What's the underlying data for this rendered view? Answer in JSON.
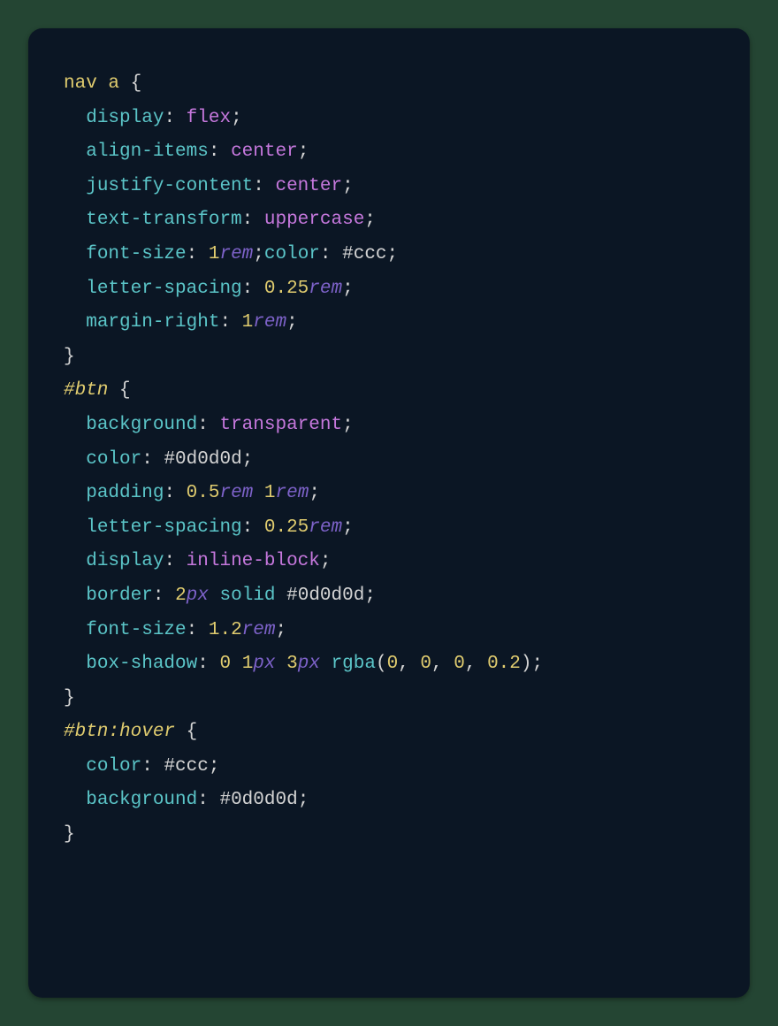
{
  "code": {
    "rules": [
      {
        "selector_parts": [
          {
            "text": "nav a",
            "cls": "tok-selector"
          }
        ],
        "decls": [
          [
            {
              "prop": "display"
            },
            {
              "value_parts": [
                {
                  "text": "flex",
                  "cls": "tok-value"
                }
              ]
            }
          ],
          [
            {
              "prop": "align-items"
            },
            {
              "value_parts": [
                {
                  "text": "center",
                  "cls": "tok-value"
                }
              ]
            }
          ],
          [
            {
              "prop": "justify-content"
            },
            {
              "value_parts": [
                {
                  "text": "center",
                  "cls": "tok-value"
                }
              ]
            }
          ],
          [
            {
              "prop": "text-transform"
            },
            {
              "value_parts": [
                {
                  "text": "uppercase",
                  "cls": "tok-value"
                }
              ]
            }
          ],
          [
            {
              "prop": "font-size"
            },
            {
              "value_parts": [
                {
                  "text": "1",
                  "cls": "tok-num"
                },
                {
                  "text": "rem",
                  "cls": "tok-unit"
                }
              ]
            },
            {
              "inline_next": {
                "prop": "color",
                "value_parts": [
                  {
                    "text": "#ccc",
                    "cls": "tok-hex"
                  }
                ]
              }
            }
          ],
          [
            {
              "prop": "letter-spacing"
            },
            {
              "value_parts": [
                {
                  "text": "0.25",
                  "cls": "tok-num"
                },
                {
                  "text": "rem",
                  "cls": "tok-unit"
                }
              ]
            }
          ],
          [
            {
              "prop": "margin-right"
            },
            {
              "value_parts": [
                {
                  "text": "1",
                  "cls": "tok-num"
                },
                {
                  "text": "rem",
                  "cls": "tok-unit"
                }
              ]
            }
          ]
        ]
      },
      {
        "selector_parts": [
          {
            "text": "#btn",
            "cls": "tok-id-italic"
          }
        ],
        "decls": [
          [
            {
              "prop": "background"
            },
            {
              "value_parts": [
                {
                  "text": "transparent",
                  "cls": "tok-value"
                }
              ]
            }
          ],
          [
            {
              "prop": "color"
            },
            {
              "value_parts": [
                {
                  "text": "#0d0d0d",
                  "cls": "tok-hex"
                }
              ]
            }
          ],
          [
            {
              "prop": "padding"
            },
            {
              "value_parts": [
                {
                  "text": "0.5",
                  "cls": "tok-num"
                },
                {
                  "text": "rem",
                  "cls": "tok-unit"
                },
                {
                  "text": " ",
                  "cls": ""
                },
                {
                  "text": "1",
                  "cls": "tok-num"
                },
                {
                  "text": "rem",
                  "cls": "tok-unit"
                }
              ]
            }
          ],
          [
            {
              "prop": "letter-spacing"
            },
            {
              "value_parts": [
                {
                  "text": "0.25",
                  "cls": "tok-num"
                },
                {
                  "text": "rem",
                  "cls": "tok-unit"
                }
              ]
            }
          ],
          [
            {
              "prop": "display"
            },
            {
              "value_parts": [
                {
                  "text": "inline-block",
                  "cls": "tok-value"
                }
              ]
            }
          ],
          [
            {
              "prop": "border"
            },
            {
              "value_parts": [
                {
                  "text": "2",
                  "cls": "tok-num"
                },
                {
                  "text": "px",
                  "cls": "tok-unit"
                },
                {
                  "text": " ",
                  "cls": ""
                },
                {
                  "text": "solid",
                  "cls": "tok-kw"
                },
                {
                  "text": " ",
                  "cls": ""
                },
                {
                  "text": "#0d0d0d",
                  "cls": "tok-hex"
                }
              ]
            }
          ],
          [
            {
              "prop": "font-size"
            },
            {
              "value_parts": [
                {
                  "text": "1.2",
                  "cls": "tok-num"
                },
                {
                  "text": "rem",
                  "cls": "tok-unit"
                }
              ]
            }
          ],
          [
            {
              "prop": "box-shadow"
            },
            {
              "value_parts": [
                {
                  "text": "0",
                  "cls": "tok-num"
                },
                {
                  "text": " ",
                  "cls": ""
                },
                {
                  "text": "1",
                  "cls": "tok-num"
                },
                {
                  "text": "px",
                  "cls": "tok-unit"
                },
                {
                  "text": " ",
                  "cls": ""
                },
                {
                  "text": "3",
                  "cls": "tok-num"
                },
                {
                  "text": "px",
                  "cls": "tok-unit"
                },
                {
                  "text": " ",
                  "cls": ""
                },
                {
                  "text": "rgba",
                  "cls": "tok-func"
                },
                {
                  "text": "(",
                  "cls": "tok-brace"
                },
                {
                  "text": "0",
                  "cls": "tok-num"
                },
                {
                  "text": ", ",
                  "cls": ""
                },
                {
                  "text": "0",
                  "cls": "tok-num"
                },
                {
                  "text": ", ",
                  "cls": ""
                },
                {
                  "text": "0",
                  "cls": "tok-num"
                },
                {
                  "text": ", ",
                  "cls": ""
                },
                {
                  "text": "0.2",
                  "cls": "tok-num"
                },
                {
                  "text": ")",
                  "cls": "tok-brace"
                }
              ]
            }
          ]
        ]
      },
      {
        "selector_parts": [
          {
            "text": "#btn",
            "cls": "tok-id-italic"
          },
          {
            "text": ":hover",
            "cls": "tok-id-italic"
          }
        ],
        "decls": [
          [
            {
              "prop": "color"
            },
            {
              "value_parts": [
                {
                  "text": "#ccc",
                  "cls": "tok-hex"
                }
              ]
            }
          ],
          [
            {
              "prop": "background"
            },
            {
              "value_parts": [
                {
                  "text": "#0d0d0d",
                  "cls": "tok-hex"
                }
              ]
            }
          ]
        ]
      }
    ]
  }
}
